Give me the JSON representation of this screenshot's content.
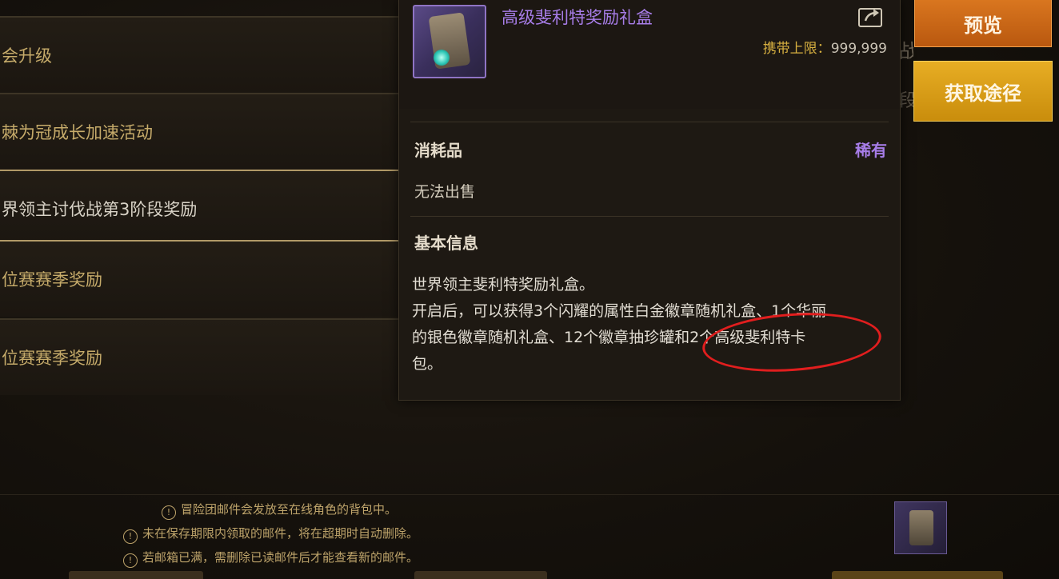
{
  "mail_list": [
    {
      "title": "会升级",
      "selected": false
    },
    {
      "title": "棘为冠成长加速活动",
      "selected": false
    },
    {
      "title": "界领主讨伐战第3阶段奖励",
      "selected": true
    },
    {
      "title": "位赛赛季奖励",
      "selected": false
    },
    {
      "title": "位赛赛季奖励",
      "selected": false
    }
  ],
  "tooltip": {
    "item_name": "高级斐利特奖励礼盒",
    "carry_limit_label": "携带上限：",
    "carry_limit_value": "999,999",
    "type": "消耗品",
    "rarity": "稀有",
    "sell_status": "无法出售",
    "basic_info_title": "基本信息",
    "desc_line1": "世界领主斐利特奖励礼盒。",
    "desc_line2": "开启后，可以获得3个闪耀的属性白金徽章随机礼盒、1个华丽",
    "desc_line3": "的银色徽章随机礼盒、12个徽章抽珍罐和2个高级斐利特卡",
    "desc_line4": "包。"
  },
  "buttons": {
    "preview": "预览",
    "source": "获取途径"
  },
  "notices": [
    "冒险团邮件会发放至在线角色的背包中。",
    "未在保存期限内领取的邮件，将在超期时自动删除。",
    "若邮箱已满，需删除已读邮件后才能查看新的邮件。"
  ],
  "colors": {
    "rare_purple": "#a77de8",
    "gold_text": "#c6ab6a",
    "highlight_circle": "#e11e1e"
  }
}
